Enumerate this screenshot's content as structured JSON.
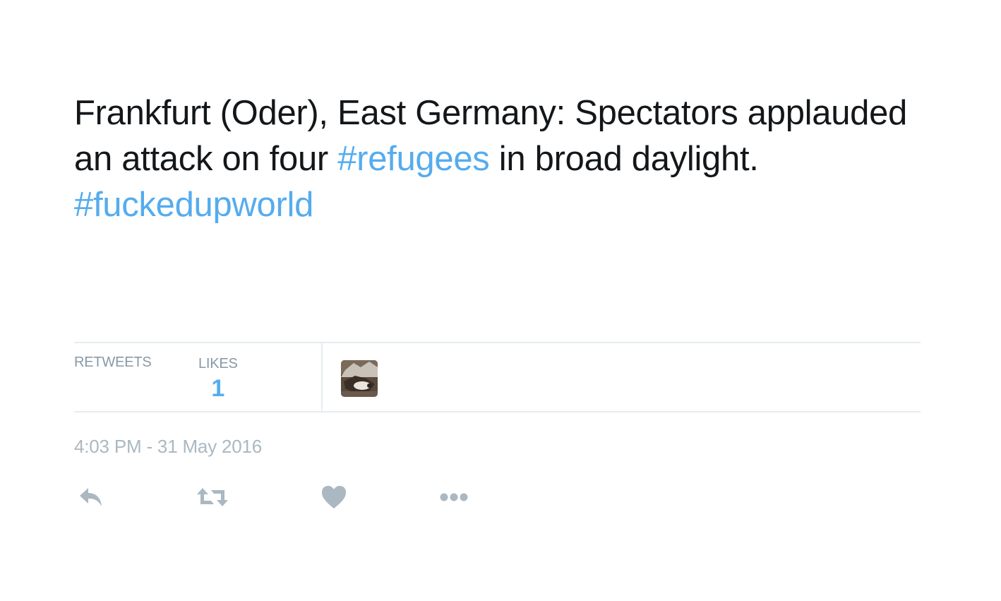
{
  "tweet": {
    "text_parts": {
      "part1": "Frankfurt (Oder), East Germany: Spectators applauded an attack on four ",
      "hashtag1": "#refugees",
      "part2": " in broad daylight. ",
      "hashtag2": "#fuckedupworld"
    },
    "stats": {
      "retweets_label": "RETWEETS",
      "likes_label": "LIKES",
      "likes_count": "1"
    },
    "timestamp": "4:03 PM - 31 May 2016",
    "colors": {
      "text": "#14171a",
      "hashtag": "#55acee",
      "muted": "#8899a6",
      "icon": "#aab8c2",
      "divider": "#e6ecf0"
    },
    "icons": {
      "reply": "reply-icon",
      "retweet": "retweet-icon",
      "like": "heart-icon",
      "more": "more-icon"
    }
  }
}
